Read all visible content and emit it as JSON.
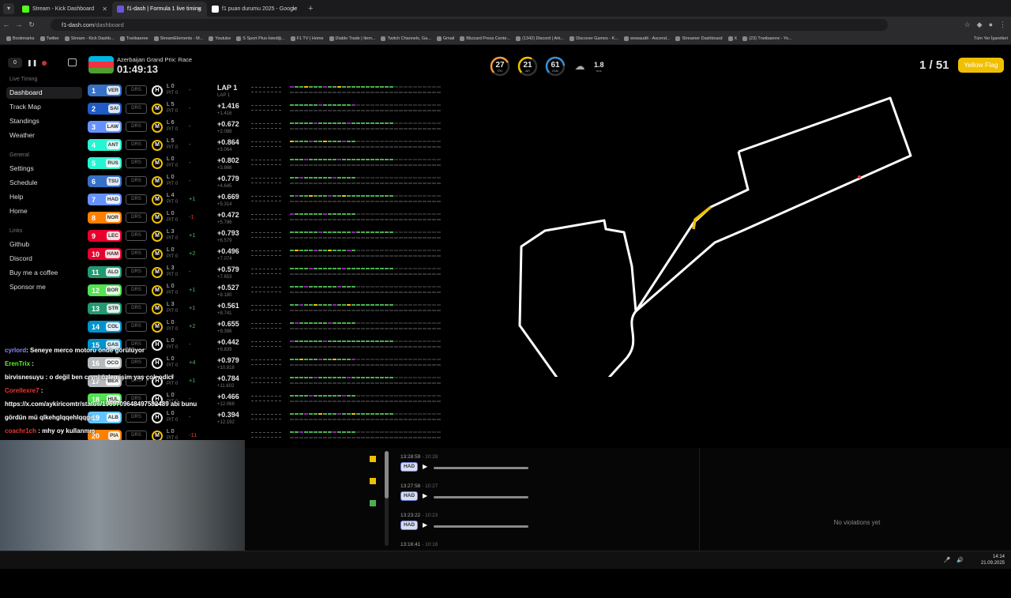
{
  "browser": {
    "tabs": [
      {
        "title": "Stream - Kick Dashboard",
        "color": "#53fc18",
        "active": false
      },
      {
        "title": "f1-dash | Formula 1 live timing",
        "color": "#6b57d6",
        "active": true
      },
      {
        "title": "f1 puan durumu 2025 - Google",
        "color": "#ffffff",
        "active": false
      }
    ],
    "url_host": "f1-dash.com",
    "url_path": "/dashboard",
    "bookmarks": [
      "Bookmarks",
      "Twitter",
      "Stream - Kick Dashb...",
      "Tneibaenre",
      "StreamElements - M...",
      "Youtube",
      "S Sport Plus-İstediğ...",
      "F1 TV | Home",
      "Diablo Trade | Item...",
      "Twitch Channels, Ga...",
      "Gmail",
      "Blizzard Press Cente...",
      "(1342) Discord | Ark...",
      "Discover Games - K...",
      "wowaudit - Ascend...",
      "Streamer Dashboard",
      "X",
      "(23) Tneibaenre - Yo..."
    ],
    "bookmarks_right": "Tüm Yer İşaretleri"
  },
  "sidebar": {
    "counter": "0",
    "section_live": "Live Timing",
    "live_items": [
      "Dashboard",
      "Track Map",
      "Standings",
      "Weather"
    ],
    "section_general": "General",
    "general_items": [
      "Settings",
      "Schedule",
      "Help",
      "Home"
    ],
    "section_links": "Links",
    "link_items": [
      "Github",
      "Discord",
      "Buy me a coffee",
      "Sponsor me"
    ]
  },
  "header": {
    "race_name": "Azerbaijan Grand Prix: Race",
    "race_time": "01:49:13",
    "flag_colors": [
      "#00b5e2",
      "#ef3340",
      "#509e2f"
    ],
    "lap_count": "1 / 51",
    "flag_status": "Yellow Flag",
    "weather": [
      {
        "value": "27",
        "label": "TRC",
        "color": "#f29b38",
        "fraction": 0.55
      },
      {
        "value": "21",
        "label": "AIR",
        "color": "#f0c000",
        "fraction": 0.45
      },
      {
        "value": "61",
        "label": "HUM",
        "color": "#3a8fd9",
        "fraction": 0.61
      }
    ],
    "wind_speed": "1.8",
    "wind_unit": "m/s"
  },
  "drivers": [
    {
      "pos": "1",
      "code": "VER",
      "color": "#3671c6",
      "tyre": "H",
      "lap": "L 0",
      "pit": "PIT 0",
      "delta": "-",
      "gap": "LAP 1",
      "int": "LAP 1"
    },
    {
      "pos": "2",
      "code": "SAI",
      "color": "#1e5bc6",
      "tyre": "M",
      "lap": "L 5",
      "pit": "PIT 0",
      "delta": "-",
      "gap": "+1.416",
      "int": "+1.416"
    },
    {
      "pos": "3",
      "code": "LAW",
      "color": "#6692ff",
      "tyre": "M",
      "lap": "L 6",
      "pit": "PIT 0",
      "delta": "-",
      "gap": "+0.672",
      "int": "+2.088"
    },
    {
      "pos": "4",
      "code": "ANT",
      "color": "#27f4d2",
      "tyre": "M",
      "lap": "L 5",
      "pit": "PIT 0",
      "delta": "-",
      "gap": "+0.864",
      "int": "+3.064"
    },
    {
      "pos": "5",
      "code": "RUS",
      "color": "#27f4d2",
      "tyre": "M",
      "lap": "L 0",
      "pit": "PIT 0",
      "delta": "-",
      "gap": "+0.802",
      "int": "+3.866"
    },
    {
      "pos": "6",
      "code": "TSU",
      "color": "#3671c6",
      "tyre": "M",
      "lap": "L 0",
      "pit": "PIT 0",
      "delta": "-",
      "gap": "+0.779",
      "int": "+4.645"
    },
    {
      "pos": "7",
      "code": "HAD",
      "color": "#6692ff",
      "tyre": "M",
      "lap": "L 4",
      "pit": "PIT 0",
      "delta": "+1",
      "gap": "+0.669",
      "int": "+5.314"
    },
    {
      "pos": "8",
      "code": "NOR",
      "color": "#ff8000",
      "tyre": "M",
      "lap": "L 0",
      "pit": "PIT 0",
      "delta": "-1",
      "gap": "+0.472",
      "int": "+5.786"
    },
    {
      "pos": "9",
      "code": "LEC",
      "color": "#e8002d",
      "tyre": "M",
      "lap": "L 3",
      "pit": "PIT 0",
      "delta": "+1",
      "gap": "+0.793",
      "int": "+6.579"
    },
    {
      "pos": "10",
      "code": "HAM",
      "color": "#e8002d",
      "tyre": "M",
      "lap": "L 0",
      "pit": "PIT 0",
      "delta": "+2",
      "gap": "+0.496",
      "int": "+7.074"
    },
    {
      "pos": "11",
      "code": "ALO",
      "color": "#229971",
      "tyre": "M",
      "lap": "L 3",
      "pit": "PIT 0",
      "delta": "-",
      "gap": "+0.579",
      "int": "+7.653"
    },
    {
      "pos": "12",
      "code": "BOR",
      "color": "#52e252",
      "tyre": "M",
      "lap": "L 0",
      "pit": "PIT 0",
      "delta": "+1",
      "gap": "+0.527",
      "int": "+8.180"
    },
    {
      "pos": "13",
      "code": "STR",
      "color": "#229971",
      "tyre": "M",
      "lap": "L 3",
      "pit": "PIT 0",
      "delta": "+1",
      "gap": "+0.561",
      "int": "+8.741"
    },
    {
      "pos": "14",
      "code": "COL",
      "color": "#0093cc",
      "tyre": "M",
      "lap": "L 0",
      "pit": "PIT 0",
      "delta": "+2",
      "gap": "+0.655",
      "int": "+9.396"
    },
    {
      "pos": "15",
      "code": "GAS",
      "color": "#0093cc",
      "tyre": "H",
      "lap": "L 0",
      "pit": "PIT 0",
      "delta": "-",
      "gap": "+0.442",
      "int": "+9.839"
    },
    {
      "pos": "16",
      "code": "OCO",
      "color": "#b6babd",
      "tyre": "H",
      "lap": "L 0",
      "pit": "PIT 0",
      "delta": "+4",
      "gap": "+0.979",
      "int": "+10.818"
    },
    {
      "pos": "17",
      "code": "BEA",
      "color": "#b6babd",
      "tyre": "H",
      "lap": "L 0",
      "pit": "PIT 0",
      "delta": "+1",
      "gap": "+0.784",
      "int": "+11.602"
    },
    {
      "pos": "18",
      "code": "HUL",
      "color": "#52e252",
      "tyre": "H",
      "lap": "L 0",
      "pit": "PIT 0",
      "delta": "-",
      "gap": "+0.466",
      "int": "+12.068"
    },
    {
      "pos": "19",
      "code": "ALB",
      "color": "#64c4ff",
      "tyre": "H",
      "lap": "L 0",
      "pit": "PIT 0",
      "delta": "-",
      "gap": "+0.394",
      "int": "+12.192"
    },
    {
      "pos": "20",
      "code": "PIA",
      "color": "#ff8000",
      "tyre": "M",
      "lap": "L 0",
      "pit": "PIT 0",
      "delta": "-11",
      "gap": "",
      "int": ""
    }
  ],
  "chat": [
    {
      "user": "cyrlord",
      "color": "#8a8aff",
      "text": ": Seneye merco motoru önde görülüyor"
    },
    {
      "user": "ErenTrix",
      "color": "#53fc18",
      "text": " :"
    },
    {
      "user": "birvisnesuyu",
      "color": "#ffffff",
      "text": " : o değil ben cryni özlemişim yaş çok odici"
    },
    {
      "user": "CorelIexre7",
      "color": "#e53935",
      "text": " :"
    },
    {
      "user": "",
      "color": "#ffffff",
      "text": "https://x.com/aykiricomtr/status/1969709648497582489 abi bunu"
    },
    {
      "user": "",
      "color": "#ffffff",
      "text": "gördün mü qlkehglqqehlqqge"
    },
    {
      "user": "coachr1ch",
      "color": "#e53935",
      "text": " : mhy oy kullanmış"
    }
  ],
  "radio": [
    {
      "time": "13:28:59",
      "local": "10:28",
      "driver": "HAD"
    },
    {
      "time": "13:27:58",
      "local": "10:27",
      "driver": "HAD"
    },
    {
      "time": "13:23:22",
      "local": "10:23",
      "driver": "HAD"
    },
    {
      "time": "13:16:41",
      "local": "10:16",
      "driver": ""
    }
  ],
  "race_control_flags": [
    "#f0c000",
    "#f0c000",
    "#4caf50"
  ],
  "violations_text": "No violations yet",
  "taskbar": {
    "time": "14:14",
    "date": "21.09.2025"
  }
}
